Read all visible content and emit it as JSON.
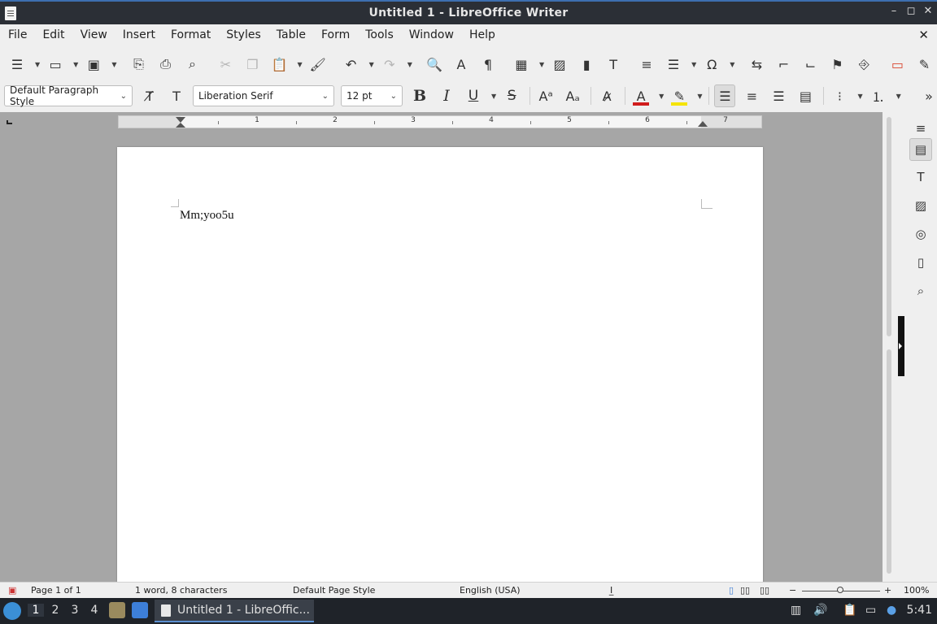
{
  "window": {
    "title": "Untitled 1 - LibreOffice Writer",
    "minimize": "–",
    "maximize": "◻",
    "close": "✕"
  },
  "menubar": {
    "items": [
      "File",
      "Edit",
      "View",
      "Insert",
      "Format",
      "Styles",
      "Table",
      "Form",
      "Tools",
      "Window",
      "Help"
    ],
    "close_document": "✕"
  },
  "formatting": {
    "paragraph_style": "Default Paragraph Style",
    "font_name": "Liberation Serif",
    "font_size": "12 pt",
    "bold": "B",
    "italic": "I",
    "underline": "U",
    "strikethrough": "S",
    "font_color_hex": "#d01c1c",
    "highlight_color_hex": "#f5e400"
  },
  "ruler": {
    "numbers": [
      "1",
      "2",
      "3",
      "4",
      "5",
      "6",
      "7"
    ]
  },
  "document": {
    "text": "Mm;yoo5u"
  },
  "statusbar": {
    "page": "Page 1 of 1",
    "word_count": "1 word, 8 characters",
    "page_style": "Default Page Style",
    "language": "English (USA)",
    "zoom_minus": "−",
    "zoom_plus": "+",
    "zoom": "100%"
  },
  "taskbar": {
    "workspaces": [
      "1",
      "2",
      "3",
      "4"
    ],
    "active_window": "Untitled 1 - LibreOffic...",
    "clock": "5:41"
  }
}
